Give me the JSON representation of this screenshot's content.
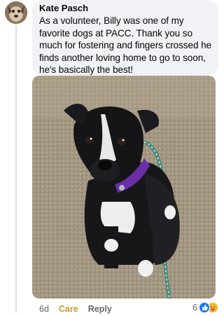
{
  "comment": {
    "author": "Kate Pasch",
    "text": "As a volunteer, Billy was one of my favorite dogs at PACC. Thank you so much for fostering and fingers crossed he finds another loving home to go to soon, he's basically the best!"
  },
  "actions": {
    "time": "6d",
    "reaction": "Care",
    "reply": "Reply"
  },
  "reactions": {
    "count": "6",
    "icons": [
      "like-icon",
      "care-icon"
    ]
  },
  "colors": {
    "bubble": "#f0f2f5",
    "care_text": "#c89b2b",
    "like_blue": "#1877f2",
    "care_yellow": "#f7b928"
  }
}
